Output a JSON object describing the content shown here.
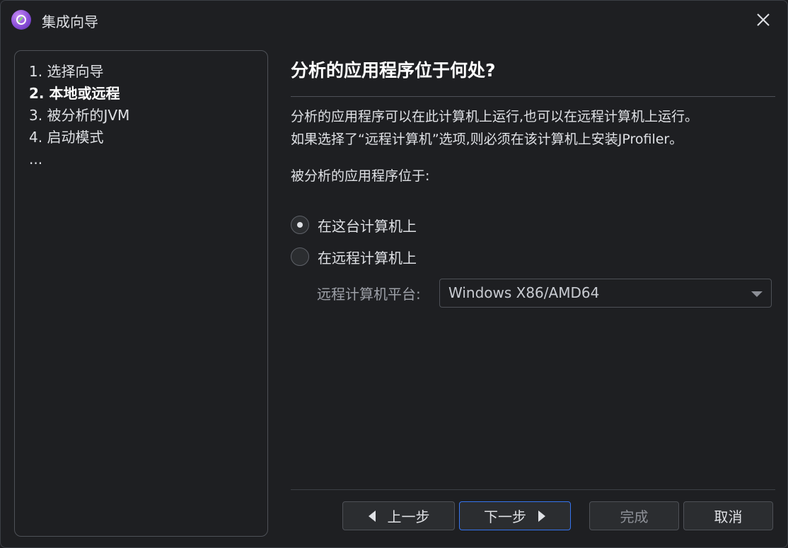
{
  "window": {
    "title": "集成向导",
    "icon": "jprofiler-app-icon"
  },
  "steps": [
    {
      "label": "1. 选择向导",
      "current": false
    },
    {
      "label": "2. 本地或远程",
      "current": true
    },
    {
      "label": "3. 被分析的JVM",
      "current": false
    },
    {
      "label": "4. 启动模式",
      "current": false
    },
    {
      "label": "...",
      "current": false
    }
  ],
  "content": {
    "heading": "分析的应用程序位于何处?",
    "desc_line1": "分析的应用程序可以在此计算机上运行,也可以在远程计算机上运行。",
    "desc_line2": "如果选择了“远程计算机”选项,则必须在该计算机上安装JProfiler。",
    "location_label": "被分析的应用程序位于:",
    "options": [
      {
        "label": "在这台计算机上",
        "selected": true
      },
      {
        "label": "在远程计算机上",
        "selected": false
      }
    ],
    "platform": {
      "label": "远程计算机平台:",
      "value": "Windows X86/AMD64"
    }
  },
  "buttons": {
    "prev": "上一步",
    "next": "下一步",
    "finish": "完成",
    "cancel": "取消"
  },
  "colors": {
    "accent": "#3574f0",
    "background": "#1e1f22",
    "border": "#4e5157"
  }
}
